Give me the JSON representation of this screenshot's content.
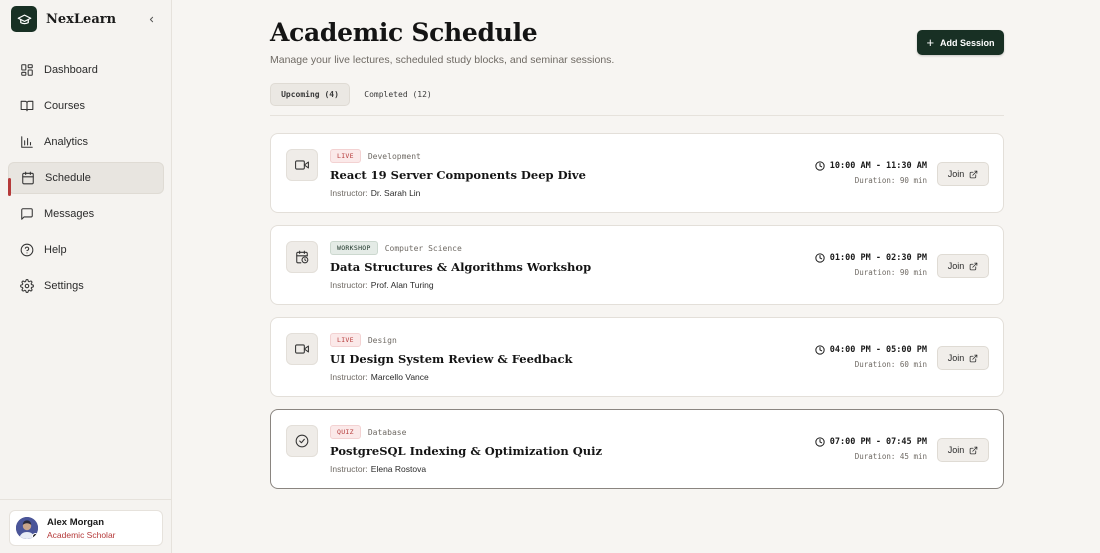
{
  "brand": {
    "name": "NexLearn"
  },
  "sidebar": {
    "items": [
      {
        "label": "Dashboard",
        "icon": "dashboard-icon"
      },
      {
        "label": "Courses",
        "icon": "book-icon"
      },
      {
        "label": "Analytics",
        "icon": "bar-chart-icon"
      },
      {
        "label": "Schedule",
        "icon": "calendar-icon",
        "active": true
      },
      {
        "label": "Messages",
        "icon": "message-icon"
      },
      {
        "label": "Help",
        "icon": "help-icon"
      },
      {
        "label": "Settings",
        "icon": "gear-icon"
      }
    ]
  },
  "user": {
    "name": "Alex Morgan",
    "role": "Academic Scholar"
  },
  "header": {
    "title": "Academic Schedule",
    "subtitle": "Manage your live lectures, scheduled study blocks, and seminar sessions.",
    "add_label": "Add Session"
  },
  "tabs": [
    {
      "label": "Upcoming (4)",
      "active": true
    },
    {
      "label": "Completed (12)",
      "active": false
    }
  ],
  "sessions": [
    {
      "badge": "LIVE",
      "category": "Development",
      "title": "React 19 Server Components Deep Dive",
      "instructor_label": "Instructor:",
      "instructor": "Dr. Sarah Lin",
      "time": "10:00 AM - 11:30 AM",
      "duration": "Duration: 90 min",
      "join": "Join",
      "icon": "video-icon"
    },
    {
      "badge": "WORKSHOP",
      "category": "Computer Science",
      "title": "Data Structures & Algorithms Workshop",
      "instructor_label": "Instructor:",
      "instructor": "Prof. Alan Turing",
      "time": "01:00 PM - 02:30 PM",
      "duration": "Duration: 90 min",
      "join": "Join",
      "icon": "calendar-clock-icon"
    },
    {
      "badge": "LIVE",
      "category": "Design",
      "title": "UI Design System Review & Feedback",
      "instructor_label": "Instructor:",
      "instructor": "Marcello Vance",
      "time": "04:00 PM - 05:00 PM",
      "duration": "Duration: 60 min",
      "join": "Join",
      "icon": "video-icon"
    },
    {
      "badge": "QUIZ",
      "category": "Database",
      "title": "PostgreSQL Indexing & Optimization Quiz",
      "instructor_label": "Instructor:",
      "instructor": "Elena Rostova",
      "time": "07:00 PM - 07:45 PM",
      "duration": "Duration: 45 min",
      "join": "Join",
      "icon": "check-circle-icon"
    }
  ],
  "colors": {
    "brand": "#183024",
    "accent": "#b53a3a",
    "background": "#f7f5f2"
  }
}
